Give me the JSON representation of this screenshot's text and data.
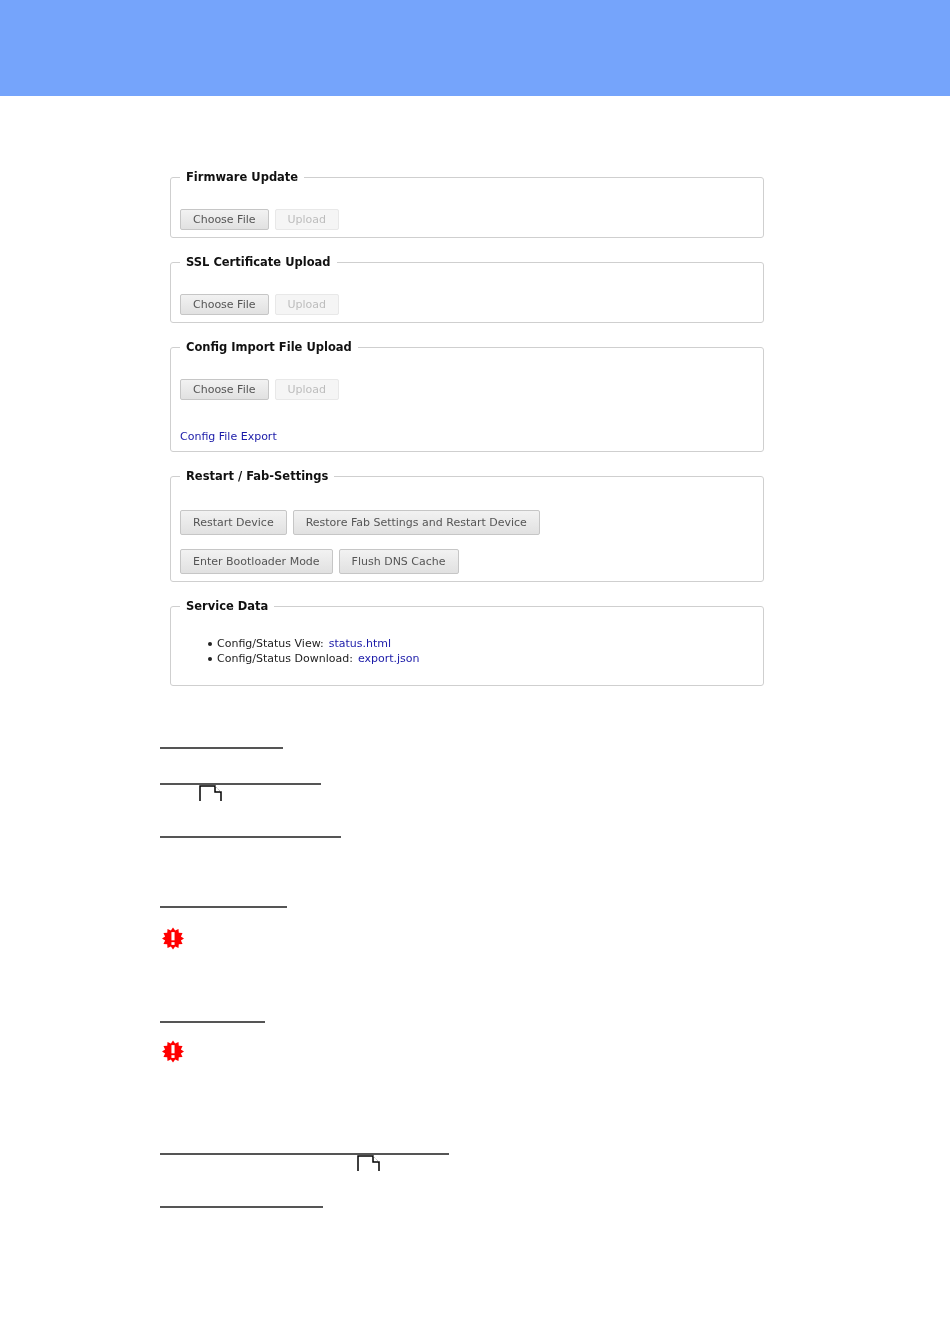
{
  "sections": [
    {
      "title": "Firmware Update",
      "rows": [
        {
          "kind": "upload",
          "buttons": [
            {
              "label": "Choose File",
              "disabled": false
            },
            {
              "label": "Upload",
              "disabled": true
            }
          ]
        }
      ]
    },
    {
      "title": "SSL Certificate Upload",
      "rows": [
        {
          "kind": "upload",
          "buttons": [
            {
              "label": "Choose File",
              "disabled": false
            },
            {
              "label": "Upload",
              "disabled": true
            }
          ]
        }
      ]
    },
    {
      "title": "Config Import File Upload",
      "rows": [
        {
          "kind": "upload",
          "buttons": [
            {
              "label": "Choose File",
              "disabled": false
            },
            {
              "label": "Upload",
              "disabled": true
            }
          ]
        },
        {
          "kind": "link",
          "text": "Config File Export"
        }
      ]
    },
    {
      "title": "Restart / Fab-Settings",
      "rows": [
        {
          "kind": "actions",
          "buttons": [
            {
              "label": "Restart Device",
              "disabled": false
            },
            {
              "label": "Restore Fab Settings and Restart Device",
              "disabled": false
            }
          ]
        },
        {
          "kind": "actions",
          "buttons": [
            {
              "label": "Enter Bootloader Mode",
              "disabled": false
            },
            {
              "label": "Flush DNS Cache",
              "disabled": false
            }
          ]
        }
      ]
    },
    {
      "title": "Service Data",
      "rows": [
        {
          "kind": "list",
          "items": [
            {
              "label": "Config/Status View:",
              "link": "status.html"
            },
            {
              "label": "Config/Status Download:",
              "link": "export.json"
            }
          ]
        }
      ]
    }
  ]
}
